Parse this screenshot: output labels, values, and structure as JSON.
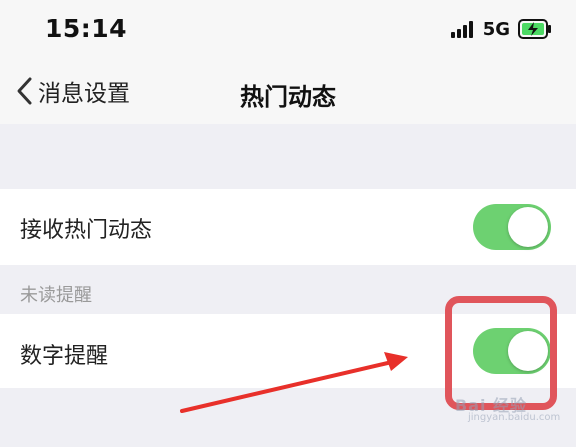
{
  "status_bar": {
    "time": "15:14",
    "network": "5G",
    "signal_icon": "signal-bars-icon",
    "battery_icon": "battery-charging-icon"
  },
  "nav": {
    "back_label": "消息设置",
    "title": "热门动态"
  },
  "settings": {
    "receive_hot": {
      "label": "接收热门动态",
      "enabled": true
    },
    "section_header": "未读提醒",
    "number_reminder": {
      "label": "数字提醒",
      "enabled": true
    }
  },
  "colors": {
    "toggle_on": "#6dd171",
    "highlight": "#e0555b",
    "arrow": "#e8302a"
  },
  "watermark": {
    "text": "Bai 经验",
    "sub": "jingyan.baidu.com"
  }
}
